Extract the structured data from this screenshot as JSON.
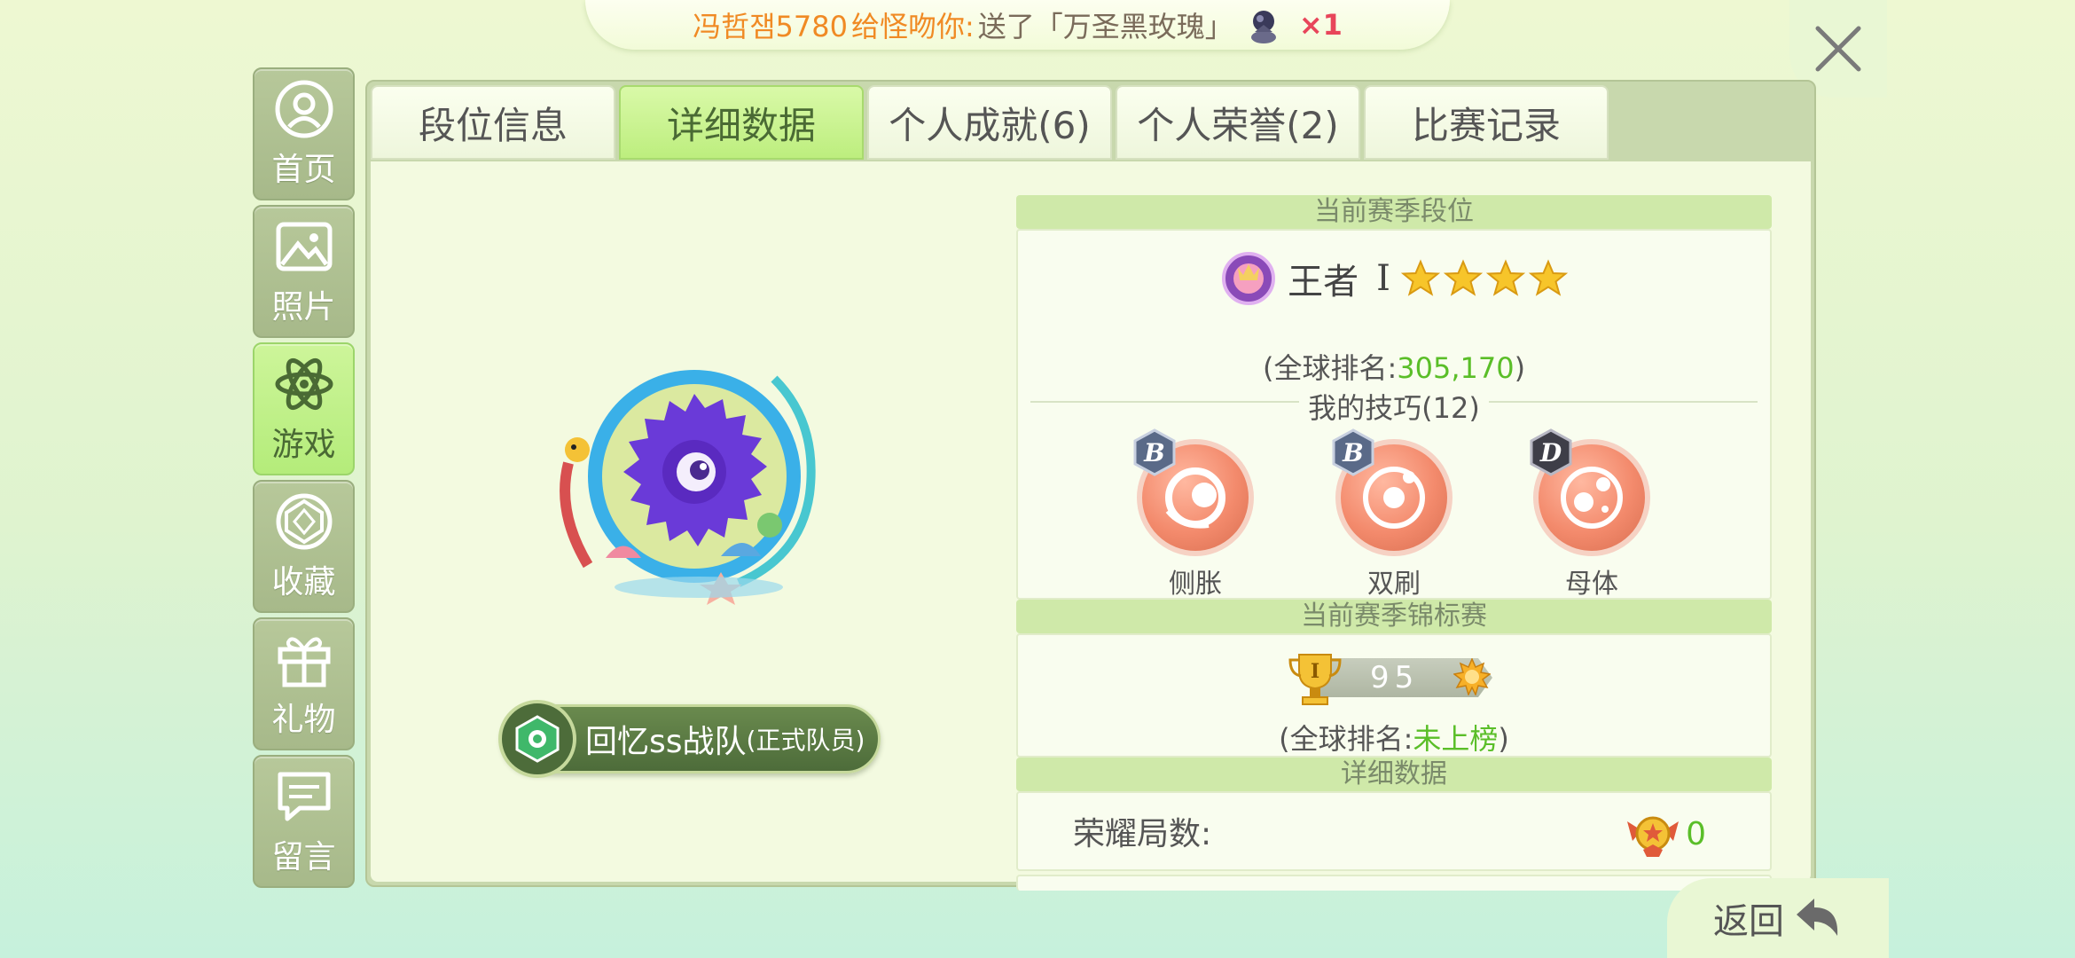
{
  "banner": {
    "sender": "冯哲잼5780",
    "mid": "给怪吻你:",
    "gift_text": "送了「万圣黑玫瑰」",
    "count": "×1"
  },
  "nav": {
    "items": [
      {
        "label": "首页",
        "icon": "user-icon"
      },
      {
        "label": "照片",
        "icon": "image-icon"
      },
      {
        "label": "游戏",
        "icon": "atom-icon",
        "active": true
      },
      {
        "label": "收藏",
        "icon": "gem-icon"
      },
      {
        "label": "礼物",
        "icon": "gift-icon"
      },
      {
        "label": "留言",
        "icon": "message-icon"
      }
    ]
  },
  "tabs": [
    {
      "label": "段位信息"
    },
    {
      "label": "详细数据",
      "active": true
    },
    {
      "label": "个人成就(6)"
    },
    {
      "label": "个人荣誉(2)"
    },
    {
      "label": "比赛记录"
    }
  ],
  "team": {
    "name": "回忆ss战队",
    "role": "(正式队员)"
  },
  "season_rank": {
    "header": "当前赛季段位",
    "rank_name": "王者",
    "rank_level": "I",
    "stars": 4,
    "global_prefix": "(全球排名:",
    "global_value": "305,170",
    "global_suffix": ")",
    "skills_title": "我的技巧(12)",
    "skills": [
      {
        "label": "侧胀",
        "grade": "B"
      },
      {
        "label": "双刷",
        "grade": "B"
      },
      {
        "label": "母体",
        "grade": "D"
      }
    ]
  },
  "championship": {
    "header": "当前赛季锦标赛",
    "trophy_level": "I",
    "score": "95",
    "global_prefix": "(全球排名:",
    "global_value": "未上榜",
    "global_suffix": ")"
  },
  "details": {
    "header": "详细数据",
    "rows": [
      {
        "label": "荣耀局数:",
        "value": "0"
      }
    ]
  },
  "back_label": "返回",
  "colors": {
    "accent_green": "#5abe28",
    "active_tab": "#bdee7e",
    "skill_orange": "#f38a6c"
  }
}
